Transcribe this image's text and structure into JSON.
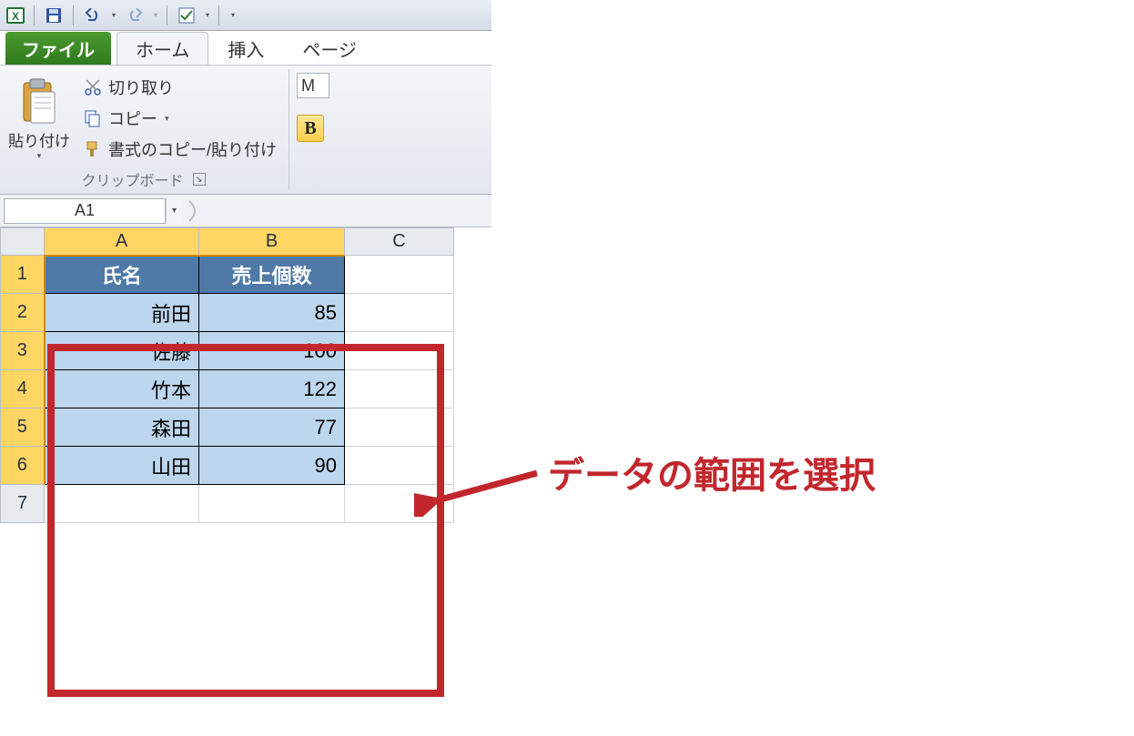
{
  "qat": {
    "app_name": "Microsoft Excel"
  },
  "tabs": {
    "file": "ファイル",
    "home": "ホーム",
    "insert": "挿入",
    "page": "ページ"
  },
  "ribbon": {
    "paste_label": "貼り付け",
    "cut": "切り取り",
    "copy": "コピー",
    "format_painter": "書式のコピー/貼り付け",
    "clipboard_group": "クリップボード",
    "font_name_stub": "M ",
    "bold": "B"
  },
  "namebox": "A1",
  "columns": [
    "A",
    "B",
    "C"
  ],
  "rows": [
    "1",
    "2",
    "3",
    "4",
    "5",
    "6",
    "7"
  ],
  "table": {
    "headers": [
      "氏名",
      "売上個数"
    ],
    "data": [
      {
        "name": "前田",
        "value": 85
      },
      {
        "name": "佐藤",
        "value": 100
      },
      {
        "name": "竹本",
        "value": 122
      },
      {
        "name": "森田",
        "value": 77
      },
      {
        "name": "山田",
        "value": 90
      }
    ]
  },
  "annotation": "データの範囲を選択"
}
